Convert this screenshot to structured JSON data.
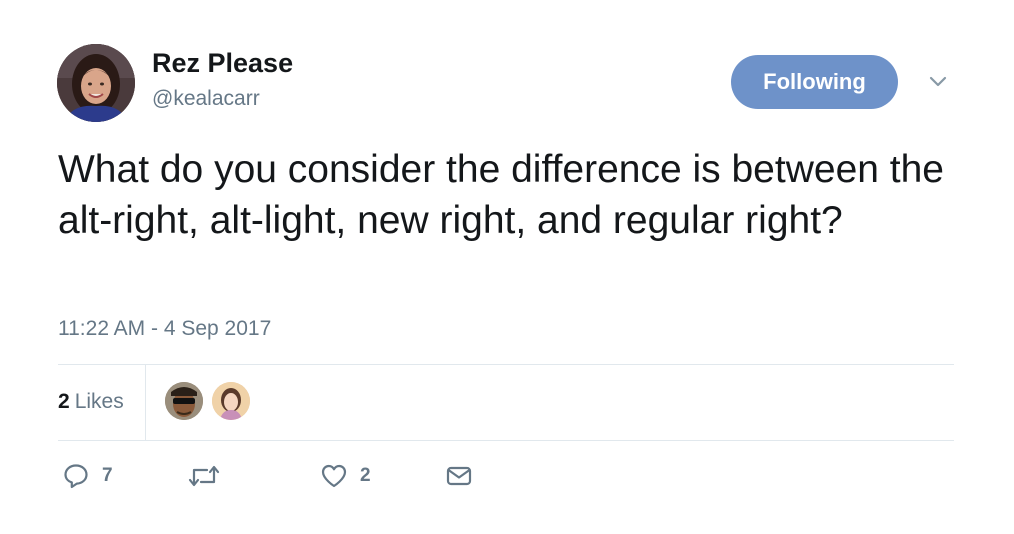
{
  "author": {
    "display_name": "Rez Please",
    "handle": "@kealacarr"
  },
  "follow_button": {
    "label": "Following",
    "color": "#6e92c9"
  },
  "tweet": {
    "text": "What do you consider the difference is between the alt-right, alt-light, new right, and regular right?",
    "timestamp": "11:22 AM - 4 Sep 2017"
  },
  "stats": {
    "likes_count": "2",
    "likes_label": "Likes",
    "likers": [
      "liker-avatar-1",
      "liker-avatar-2"
    ]
  },
  "actions": {
    "reply_icon": "reply-icon",
    "reply_count": "7",
    "retweet_icon": "retweet-icon",
    "retweet_count": "",
    "like_icon": "heart-icon",
    "like_count": "2",
    "dm_icon": "envelope-icon"
  },
  "colors": {
    "text": "#14171a",
    "secondary": "#657786",
    "divider": "#e1e8ed"
  }
}
